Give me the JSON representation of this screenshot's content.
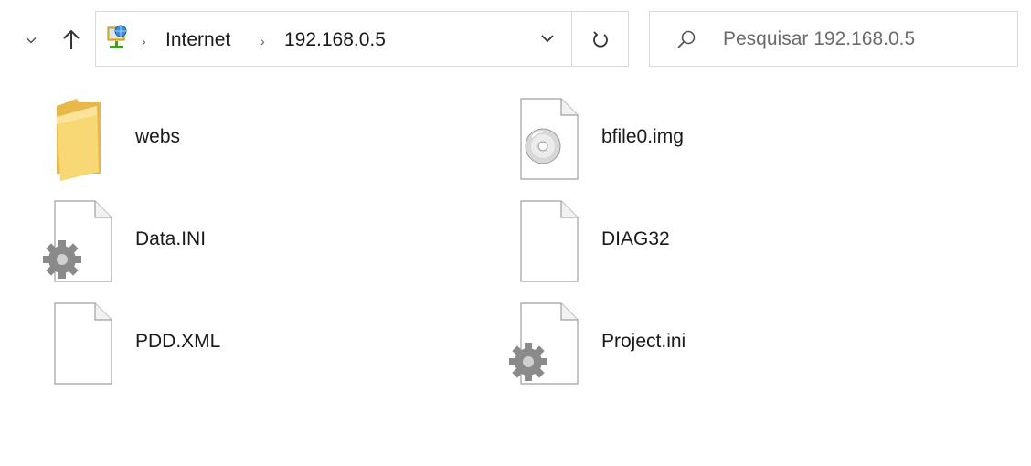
{
  "navigation": {
    "recent_icon": "chevron-down-icon",
    "up_icon": "arrow-up-icon"
  },
  "address_bar": {
    "location_icon": "network-computer-icon",
    "breadcrumbs": [
      "Internet",
      "192.168.0.5"
    ],
    "dropdown_icon": "chevron-down-icon",
    "refresh_icon": "refresh-icon"
  },
  "search": {
    "placeholder": "Pesquisar 192.168.0.5",
    "icon": "search-icon"
  },
  "files": [
    {
      "name": "webs",
      "icon": "folder-icon"
    },
    {
      "name": "bfile0.img",
      "icon": "disc-image-file-icon"
    },
    {
      "name": "Data.INI",
      "icon": "settings-file-icon"
    },
    {
      "name": "DIAG32",
      "icon": "blank-file-icon"
    },
    {
      "name": "PDD.XML",
      "icon": "blank-file-icon"
    },
    {
      "name": "Project.ini",
      "icon": "settings-file-icon"
    }
  ],
  "colors": {
    "border": "#d9d9d9",
    "folder": "#f8d775",
    "text": "#1a1a1a"
  }
}
